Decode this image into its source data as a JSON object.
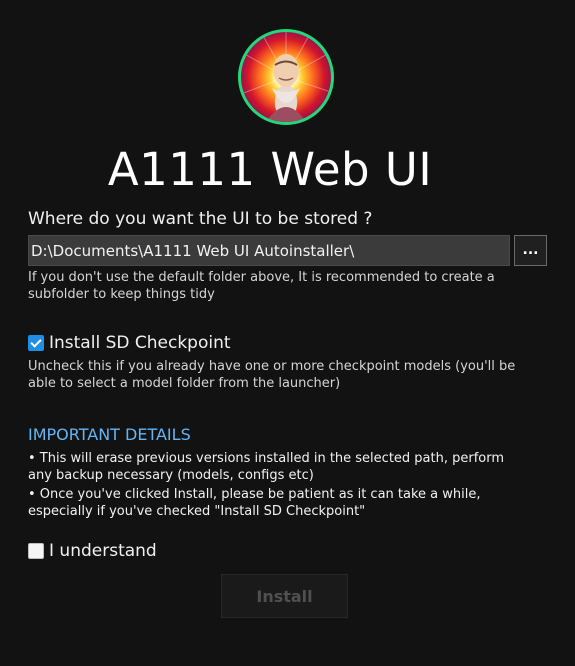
{
  "app": {
    "title": "A1111 Web UI"
  },
  "avatar": {
    "ring_color": "#22d97a"
  },
  "location": {
    "question": "Where do you want the UI to be stored ?",
    "path_value": "D:\\Documents\\A1111 Web UI Autoinstaller\\",
    "browse_label": "...",
    "hint": "If you don't use the default folder above, It is recommended to create a\nsubfolder to keep things tidy"
  },
  "checkpoint": {
    "checked": true,
    "label": "Install SD Checkpoint",
    "hint": "Uncheck this if you already have one or more checkpoint models (you'll be\nable to select a model folder from the launcher)"
  },
  "important": {
    "heading": "IMPORTANT DETAILS",
    "bullets": [
      "• This will erase previous versions installed in the selected path, perform\nany backup necessary (models, configs etc)",
      "• Once you've clicked Install, please be patient as it can take a while,\nespecially if you've checked \"Install SD Checkpoint\""
    ],
    "heading_color": "#64b5f6"
  },
  "understand": {
    "checked": false,
    "label": "I understand"
  },
  "install": {
    "label": "Install",
    "enabled": false
  },
  "colors": {
    "background": "#121212",
    "accent": "#1f8ee3"
  }
}
